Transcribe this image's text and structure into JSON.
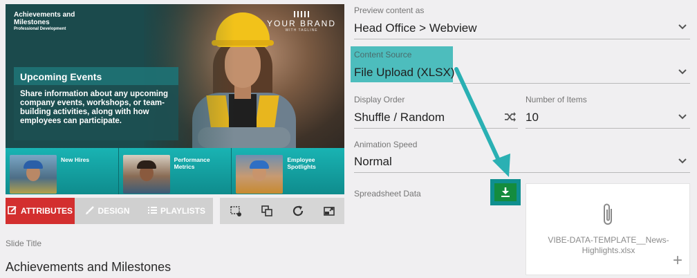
{
  "preview": {
    "title": "Achievements and Milestones",
    "subtitle": "Professional Development",
    "brand_name": "YOUR BRAND",
    "brand_tagline": "WITH TAGLINE",
    "event_heading": "Upcoming Events",
    "event_text": "Share information about any upcoming company events, workshops, or team-building activities, along with how employees can participate.",
    "tiles": [
      {
        "label": "New Hires"
      },
      {
        "label": "Performance Metrics"
      },
      {
        "label": "Employee Spotlights"
      }
    ]
  },
  "tabs": [
    {
      "label": "ATTRIBUTES",
      "icon": "edit-icon",
      "active": true
    },
    {
      "label": "DESIGN",
      "icon": "brush-icon",
      "active": false
    },
    {
      "label": "PLAYLISTS",
      "icon": "list-icon",
      "active": false
    }
  ],
  "toolbar_icons": [
    "crop-icon",
    "layers-icon",
    "refresh-icon",
    "resize-icon"
  ],
  "slide_title": {
    "label": "Slide Title",
    "value": "Achievements and Milestones"
  },
  "form": {
    "preview_content": {
      "label": "Preview content as",
      "value": "Head Office > Webview"
    },
    "content_source": {
      "label": "Content Source",
      "value": "File Upload (XLSX)"
    },
    "display_order": {
      "label": "Display Order",
      "value": "Shuffle / Random"
    },
    "number_of_items": {
      "label": "Number of Items",
      "value": "10"
    },
    "animation_speed": {
      "label": "Animation Speed",
      "value": "Normal"
    },
    "spreadsheet": {
      "label": "Spreadsheet Data",
      "filename": "VIBE-DATA-TEMPLATE__News-Highlights.xlsx",
      "add": "+"
    }
  },
  "colors": {
    "accent_red": "#d32f2f",
    "highlight_teal": "#4dbdbd",
    "download_green": "#148c3e"
  }
}
